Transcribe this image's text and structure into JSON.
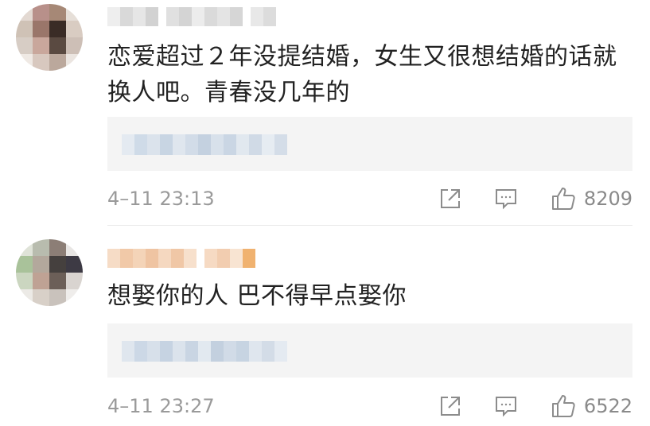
{
  "comments": [
    {
      "text_line1": "恋爱超过２年没提结婚，女生又很想结婚的话就",
      "text_line2": "换人吧。青春没几年的",
      "timestamp": "4–11 23:13",
      "likes": "8209",
      "username_color": "#d6d6d6",
      "quote_blur_color": "#cfdbe8"
    },
    {
      "text_line1": "想娶你的人 巴不得早点娶你",
      "timestamp": "4–11 23:27",
      "likes": "6522",
      "username_color": "#f3c9a8",
      "quote_blur_color": "#cfdbe8"
    }
  ],
  "icons": {
    "share": "share-icon",
    "reply": "comment-icon",
    "like": "thumbs-up-icon"
  },
  "colors": {
    "text": "#222222",
    "meta": "#9a9a9a",
    "quote_bg": "#f4f4f4",
    "divider": "#e9e9e9"
  }
}
